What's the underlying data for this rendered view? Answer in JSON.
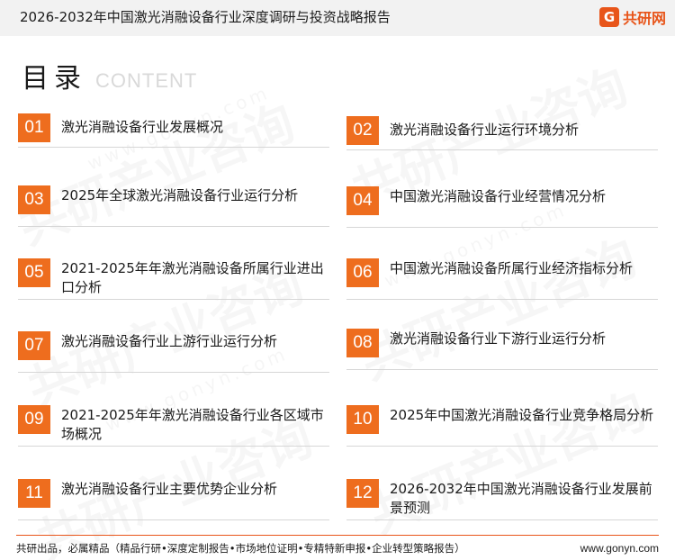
{
  "header": {
    "title": "2026-2032年中国激光消融设备行业深度调研与投资战略报告",
    "logo_mark": "G",
    "logo_text": "共研网"
  },
  "watermark": {
    "text": "共研产业咨询",
    "url": "www.gonyn.com"
  },
  "heading": {
    "main": "目录",
    "sub": "CONTENT"
  },
  "toc": [
    {
      "num": "01",
      "label": "激光消融设备行业发展概况"
    },
    {
      "num": "02",
      "label": "激光消融设备行业运行环境分析"
    },
    {
      "num": "03",
      "label": "2025年全球激光消融设备行业运行分析"
    },
    {
      "num": "04",
      "label": "中国激光消融设备行业经营情况分析"
    },
    {
      "num": "05",
      "label": "2021-2025年年激光消融设备所属行业进出口分析"
    },
    {
      "num": "06",
      "label": "中国激光消融设备所属行业经济指标分析"
    },
    {
      "num": "07",
      "label": "激光消融设备行业上游行业运行分析"
    },
    {
      "num": "08",
      "label": "激光消融设备行业下游行业运行分析"
    },
    {
      "num": "09",
      "label": "2021-2025年年激光消融设备行业各区域市场概况"
    },
    {
      "num": "10",
      "label": "2025年中国激光消融设备行业竞争格局分析"
    },
    {
      "num": "11",
      "label": "激光消融设备行业主要优势企业分析"
    },
    {
      "num": "12",
      "label": "2026-2032年中国激光消融设备行业发展前景预测"
    }
  ],
  "footer": {
    "left": "共研出品，必属精品（精品行研•深度定制报告•市场地位证明•专精特新申报•企业转型策略报告）",
    "right": "www.gonyn.com"
  },
  "colors": {
    "accent": "#ee6d1e",
    "brand": "#e8551a"
  }
}
